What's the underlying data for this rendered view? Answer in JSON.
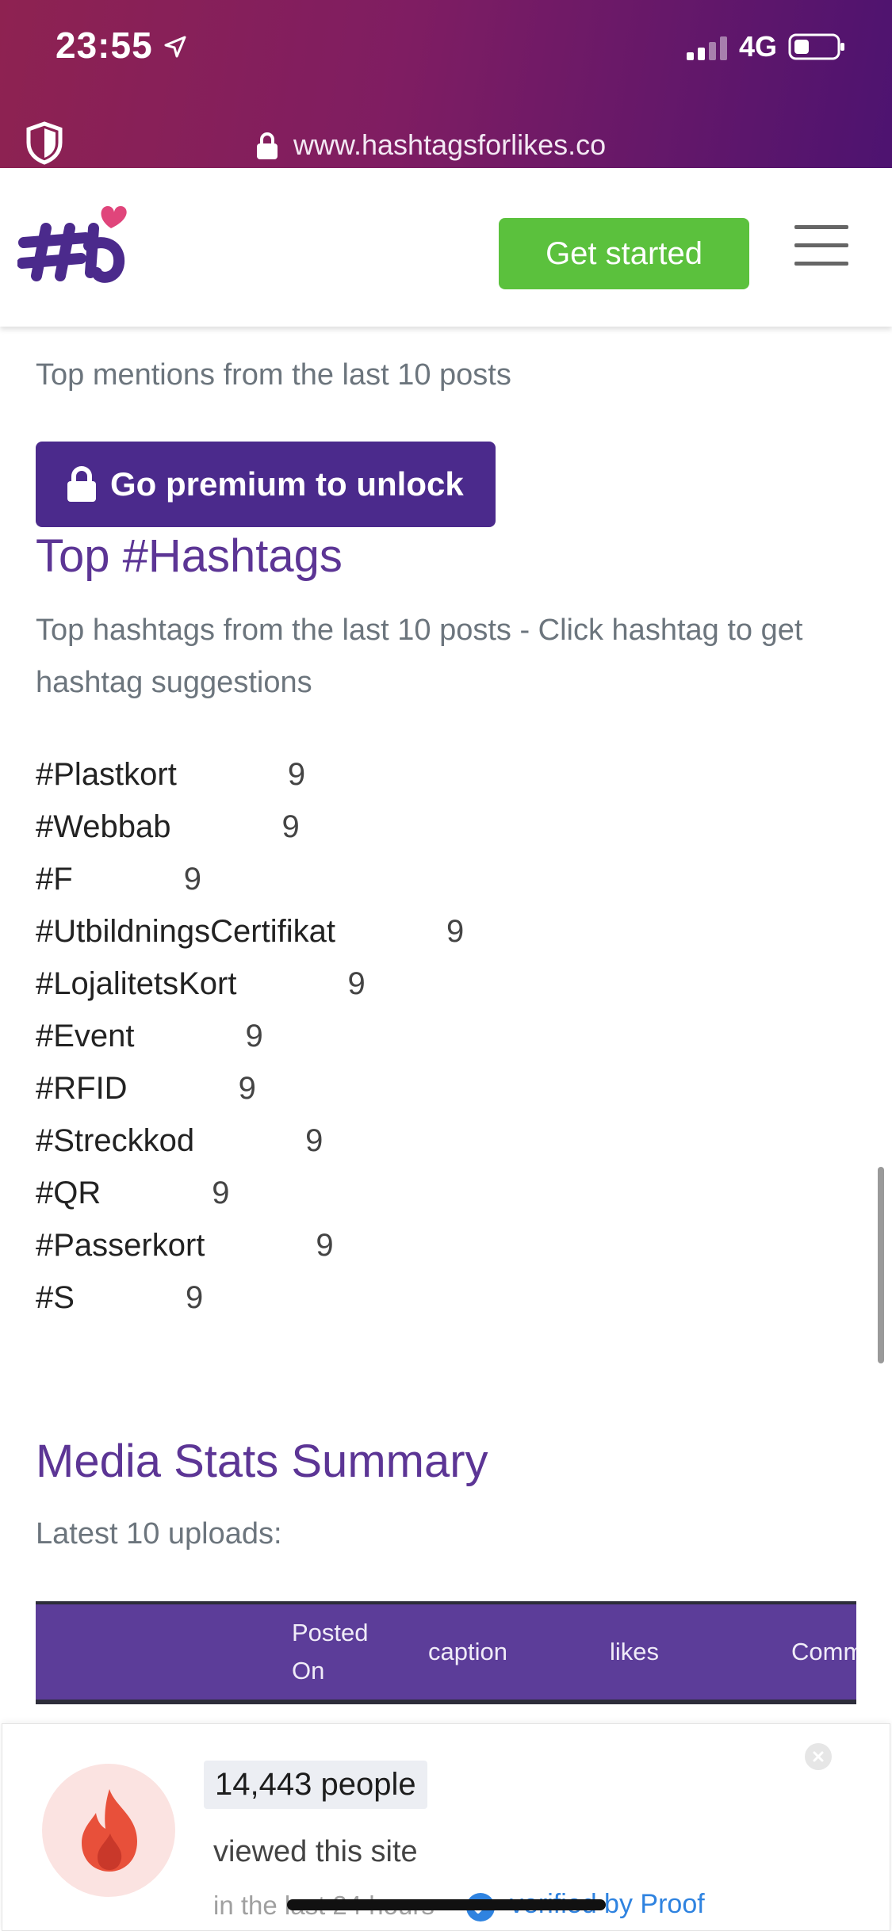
{
  "status_bar": {
    "time": "23:55",
    "network": "4G",
    "icons": [
      "location-arrow-icon",
      "signal-bars-icon",
      "battery-icon"
    ]
  },
  "browser": {
    "url": "www.hashtagsforlikes.co",
    "icons": [
      "shield-icon",
      "lock-icon"
    ]
  },
  "header": {
    "logo": "hashtagsforlikes-logo",
    "cta_label": "Get started",
    "menu_icon": "hamburger-icon"
  },
  "mentions": {
    "description": "Top mentions from the last 10 posts",
    "premium_button": "Go premium to unlock"
  },
  "hashtags": {
    "title": "Top #Hashtags",
    "description": "Top hashtags from the last 10 posts - Click hashtag to get hashtag suggestions",
    "items": [
      {
        "tag": "#Plastkort",
        "count": "9"
      },
      {
        "tag": "#Webbab",
        "count": "9"
      },
      {
        "tag": "#F",
        "count": "9"
      },
      {
        "tag": "#UtbildningsCertifikat",
        "count": "9"
      },
      {
        "tag": "#LojalitetsKort",
        "count": "9"
      },
      {
        "tag": "#Event",
        "count": "9"
      },
      {
        "tag": "#RFID",
        "count": "9"
      },
      {
        "tag": "#Streckkod",
        "count": "9"
      },
      {
        "tag": "#QR",
        "count": "9"
      },
      {
        "tag": "#Passerkort",
        "count": "9"
      },
      {
        "tag": "#S",
        "count": "9"
      }
    ]
  },
  "media_stats": {
    "title": "Media Stats Summary",
    "subtitle": "Latest 10 uploads:",
    "columns": {
      "posted_line1": "Posted",
      "posted_line2": "On",
      "caption": "caption",
      "likes": "likes",
      "comments": "Comm"
    }
  },
  "proof_popup": {
    "count": "14,443 people",
    "viewed": "viewed this site",
    "timeframe": "in the last 24 hours",
    "verified": "verified by Proof",
    "colors": {
      "fire": "#e8503a",
      "verified": "#2f83e0"
    }
  },
  "colors": {
    "brand_purple": "#5c3595",
    "premium_bg": "#4b2a8c",
    "cta_green": "#5bc13d"
  }
}
